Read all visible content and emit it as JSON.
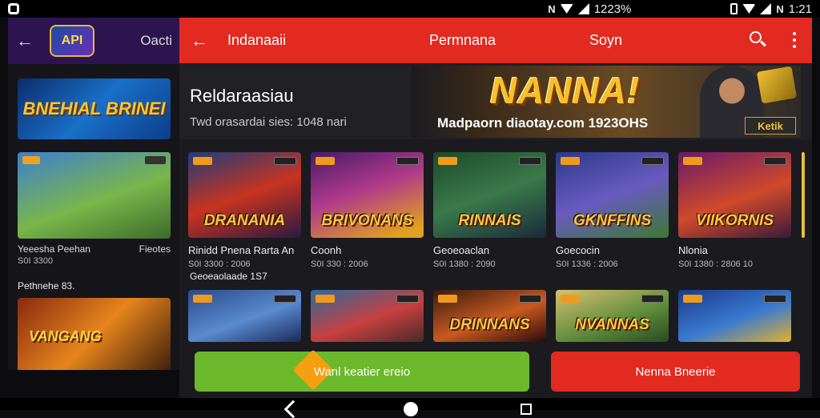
{
  "status_bar": {
    "left_icon": "square-ring-icon",
    "middle_text": "1223%",
    "time": "1:21"
  },
  "background_app": {
    "title": "Oacti",
    "logo_text": "API",
    "banner_text": "BNEHIAL BRINEI",
    "card": {
      "title": "Yeeesha Peehan",
      "meta_right": "Fieotes",
      "meta": "S0I 3300"
    },
    "section": "Pethnehe 83.",
    "card2_text": "VANGANG"
  },
  "app": {
    "header": {
      "title": "Indanaaii",
      "center": "Permnana",
      "right": "Soyn"
    },
    "hero": {
      "title": "Reldaraasiau",
      "subtitle": "Twd orasardai sies: 1048 nari",
      "brand": "NANNA!",
      "promo": "Madpaorn diaotay.com 1923OHS",
      "cta": "Ketik"
    },
    "row1": [
      {
        "logo": "DRANANIA",
        "title": "Rinidd Pnena Rarta An",
        "meta": "S0I 3300 : 2006"
      },
      {
        "logo": "BRIVONANS",
        "title": "Coonh",
        "meta": "S0I 330 : 2006"
      },
      {
        "logo": "RINNAIS",
        "title": "Geoeoaclan",
        "meta": "S0I 1380 : 2090"
      },
      {
        "logo": "GKNFFINS",
        "title": "Goecocin",
        "meta": "S0I 1336 : 2006"
      },
      {
        "logo": "VIIKORNIS",
        "title": "Nlonia",
        "meta": "S0I 1380 : 2806 10"
      }
    ],
    "section_label": "Geoeaolaade 1S7",
    "row2": [
      {
        "logo": ""
      },
      {
        "logo": ""
      },
      {
        "logo": "DRINNANS"
      },
      {
        "logo": "NVANNAS"
      },
      {
        "logo": ""
      }
    ]
  },
  "bottom_bar": {
    "primary_button": "Wanl keatier ereio",
    "secondary_button": "Nenna Bneerie"
  },
  "colors": {
    "accent_red": "#e32a20",
    "accent_green": "#6bb82a",
    "diamond_orange": "#f5a010"
  }
}
